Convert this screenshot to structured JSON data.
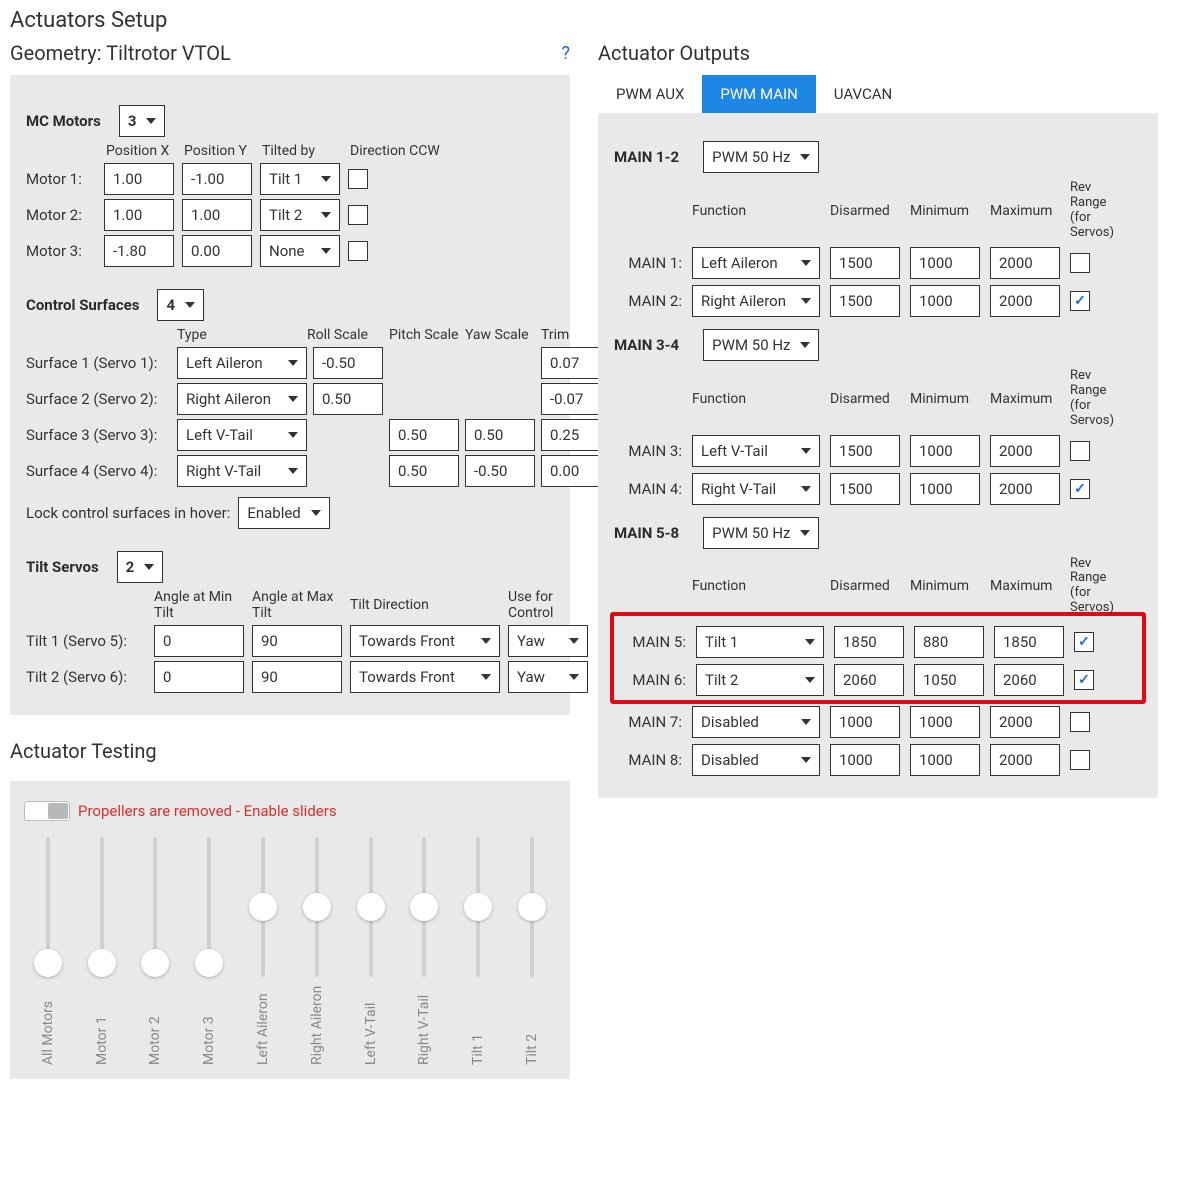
{
  "title": "Actuators Setup",
  "geometry": {
    "title": "Geometry: Tiltrotor VTOL",
    "help": "?",
    "mc_motors": {
      "label": "MC Motors",
      "count": "3",
      "headers": {
        "posx": "Position X",
        "posy": "Position Y",
        "tilted": "Tilted by",
        "dir": "Direction CCW"
      },
      "rows": [
        {
          "label": "Motor 1:",
          "posx": "1.00",
          "posy": "-1.00",
          "tilt": "Tilt 1",
          "ccw": false
        },
        {
          "label": "Motor 2:",
          "posx": "1.00",
          "posy": "1.00",
          "tilt": "Tilt 2",
          "ccw": false
        },
        {
          "label": "Motor 3:",
          "posx": "-1.80",
          "posy": "0.00",
          "tilt": "None",
          "ccw": false
        }
      ]
    },
    "surfaces": {
      "label": "Control Surfaces",
      "count": "4",
      "headers": {
        "type": "Type",
        "roll": "Roll Scale",
        "pitch": "Pitch Scale",
        "yaw": "Yaw Scale",
        "trim": "Trim"
      },
      "rows": [
        {
          "label": "Surface 1 (Servo 1):",
          "type": "Left Aileron",
          "roll": "-0.50",
          "pitch": "",
          "yaw": "",
          "trim": "0.07"
        },
        {
          "label": "Surface 2 (Servo 2):",
          "type": "Right Aileron",
          "roll": "0.50",
          "pitch": "",
          "yaw": "",
          "trim": "-0.07"
        },
        {
          "label": "Surface 3 (Servo 3):",
          "type": "Left V-Tail",
          "roll": "",
          "pitch": "0.50",
          "yaw": "0.50",
          "trim": "0.25"
        },
        {
          "label": "Surface 4 (Servo 4):",
          "type": "Right V-Tail",
          "roll": "",
          "pitch": "0.50",
          "yaw": "-0.50",
          "trim": "0.00"
        }
      ],
      "lock_label": "Lock control surfaces in hover:",
      "lock_value": "Enabled"
    },
    "tilts": {
      "label": "Tilt Servos",
      "count": "2",
      "headers": {
        "amin": "Angle at Min Tilt",
        "amax": "Angle at Max Tilt",
        "dir": "Tilt Direction",
        "use": "Use for Control"
      },
      "rows": [
        {
          "label": "Tilt 1 (Servo 5):",
          "amin": "0",
          "amax": "90",
          "dir": "Towards Front",
          "use": "Yaw"
        },
        {
          "label": "Tilt 2 (Servo 6):",
          "amin": "0",
          "amax": "90",
          "dir": "Towards Front",
          "use": "Yaw"
        }
      ]
    }
  },
  "outputs": {
    "title": "Actuator Outputs",
    "tabs": [
      "PWM AUX",
      "PWM MAIN",
      "UAVCAN"
    ],
    "active_tab": 1,
    "headers": {
      "func": "Function",
      "dis": "Disarmed",
      "min": "Minimum",
      "max": "Maximum",
      "rev": "Rev Range (for Servos)"
    },
    "groups": [
      {
        "title": "MAIN 1-2",
        "freq": "PWM 50 Hz",
        "rows": [
          {
            "label": "MAIN 1:",
            "func": "Left Aileron",
            "dis": "1500",
            "min": "1000",
            "max": "2000",
            "rev": false
          },
          {
            "label": "MAIN 2:",
            "func": "Right Aileron",
            "dis": "1500",
            "min": "1000",
            "max": "2000",
            "rev": true
          }
        ]
      },
      {
        "title": "MAIN 3-4",
        "freq": "PWM 50 Hz",
        "rows": [
          {
            "label": "MAIN 3:",
            "func": "Left V-Tail",
            "dis": "1500",
            "min": "1000",
            "max": "2000",
            "rev": false
          },
          {
            "label": "MAIN 4:",
            "func": "Right V-Tail",
            "dis": "1500",
            "min": "1000",
            "max": "2000",
            "rev": true
          }
        ]
      },
      {
        "title": "MAIN 5-8",
        "freq": "PWM 50 Hz",
        "rows": [
          {
            "label": "MAIN 5:",
            "func": "Tilt 1",
            "dis": "1850",
            "min": "880",
            "max": "1850",
            "rev": true,
            "highlight": true
          },
          {
            "label": "MAIN 6:",
            "func": "Tilt 2",
            "dis": "2060",
            "min": "1050",
            "max": "2060",
            "rev": true,
            "highlight": true
          },
          {
            "label": "MAIN 7:",
            "func": "Disabled",
            "dis": "1000",
            "min": "1000",
            "max": "2000",
            "rev": false
          },
          {
            "label": "MAIN 8:",
            "func": "Disabled",
            "dis": "1000",
            "min": "1000",
            "max": "2000",
            "rev": false
          }
        ]
      }
    ]
  },
  "testing": {
    "title": "Actuator Testing",
    "warn": "Propellers are removed - Enable sliders",
    "sliders": [
      {
        "label": "All Motors",
        "thumb": 1.0
      },
      {
        "label": "Motor 1",
        "thumb": 1.0
      },
      {
        "label": "Motor 2",
        "thumb": 1.0
      },
      {
        "label": "Motor 3",
        "thumb": 1.0
      },
      {
        "label": "Left Aileron",
        "thumb": 0.5
      },
      {
        "label": "Right Aileron",
        "thumb": 0.5
      },
      {
        "label": "Left V-Tail",
        "thumb": 0.5
      },
      {
        "label": "Right V-Tail",
        "thumb": 0.5
      },
      {
        "label": "Tilt 1",
        "thumb": 0.5
      },
      {
        "label": "Tilt 2",
        "thumb": 0.5
      }
    ]
  }
}
